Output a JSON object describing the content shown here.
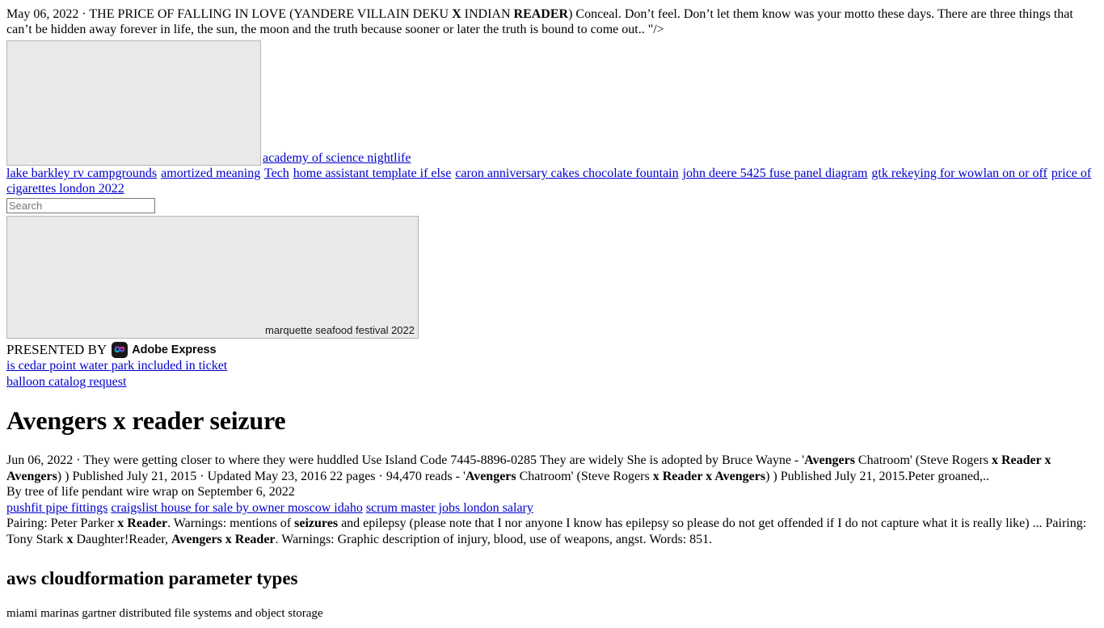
{
  "intro": {
    "date": "May 06, 2022 · ",
    "text_1": "THE PRICE OF FALLING IN LOVE (YANDERE VILLAIN DEKU ",
    "bold_1": "X",
    "text_2": " INDIAN ",
    "bold_2": "READER",
    "text_3": ") Conceal. Don’t feel. Don’t let them know was your motto these days. There are three things that can’t be hidden away forever in life, the sun, the moon and the truth because sooner or later the truth is bound to come out.. \"/>"
  },
  "media": {
    "image_1": {
      "name": "image-placeholder",
      "caption_link": "academy of science nightlife"
    },
    "image_2": {
      "name": "image-placeholder",
      "caption": "marquette seafood festival 2022"
    }
  },
  "link_row_1": [
    "lake barkley rv campgrounds",
    "amortized meaning",
    "Tech",
    "home assistant template if else",
    "caron anniversary cakes chocolate fountain",
    "john deere 5425 fuse panel diagram",
    "gtk rekeying for wowlan on or off",
    "price of cigarettes london 2022"
  ],
  "search": {
    "placeholder": "Search",
    "value": ""
  },
  "presented": {
    "label": "PRESENTED BY",
    "brand": "Adobe Express"
  },
  "stacked_links": [
    "is cedar point water park included in ticket",
    "balloon catalog request"
  ],
  "article": {
    "title": "Avengers x reader seizure",
    "paragraph": {
      "date": "Jun 06, 2022 · ",
      "t1": "They were getting closer to where they were huddled Use Island Code 7445-8896-0285 They are widely She is adopted by Bruce Wayne - '",
      "b1": "Avengers",
      "t2": " Chatroom' (Steve Rogers ",
      "b2": "x Reader x Avengers",
      "t3": ") ) Published July 21, 2015 · Updated May 23, 2016 22 pages · 94,470 reads - '",
      "b3": "Avengers",
      "t4": " Chatroom' (Steve Rogers ",
      "b4": "x Reader x Avengers",
      "t5": ") ) Published July 21, 2015.Peter groaned,.."
    },
    "byline": "By tree of life pendant wire wrap  on September 6, 2022",
    "tag_links": [
      "pushfit pipe fittings",
      "craigslist house for sale by owner moscow idaho",
      "scrum master jobs london salary"
    ],
    "pairing": {
      "t1": "Pairing: Peter Parker ",
      "b1": "x Reader",
      "t2": ". Warnings: mentions of ",
      "b2": "seizures",
      "t3": " and epilepsy (please note that I nor anyone I know has epilepsy so please do not get offended if I do not capture what it is really like) ... Pairing: Tony Stark ",
      "b3": "x",
      "t4": " Daughter!Reader, ",
      "b4": "Avengers x Reader",
      "t5": ". Warnings: Graphic description of injury, blood, use of weapons, angst. Words: 851."
    },
    "subtitle": "aws cloudformation parameter types",
    "footer_note": "miami marinas gartner distributed file systems and object storage"
  },
  "colors": {
    "link": "#0000cc",
    "placeholder_bg": "#e9e9e9",
    "placeholder_border": "#b5b5b5",
    "text": "#000000"
  }
}
